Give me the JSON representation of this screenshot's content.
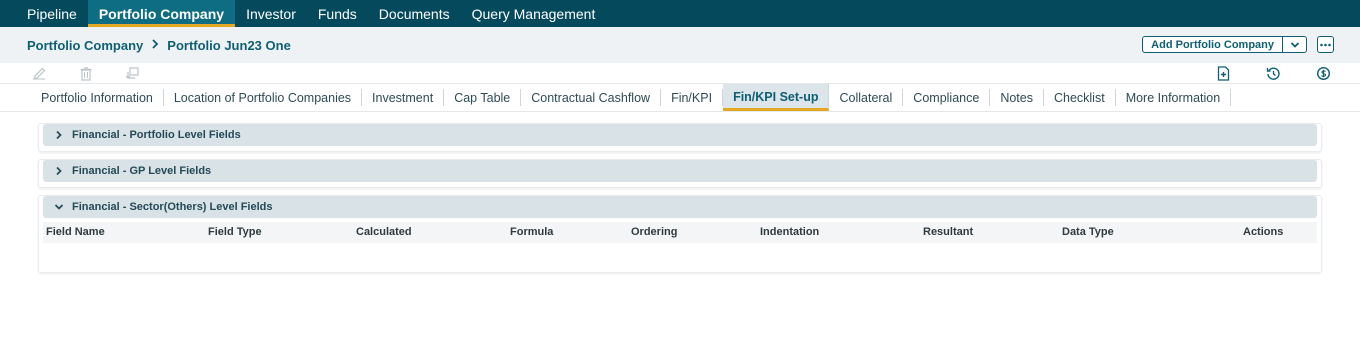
{
  "topnav": {
    "items": [
      {
        "label": "Pipeline"
      },
      {
        "label": "Portfolio Company"
      },
      {
        "label": "Investor"
      },
      {
        "label": "Funds"
      },
      {
        "label": "Documents"
      },
      {
        "label": "Query Management"
      }
    ],
    "active_index": 1
  },
  "breadcrumb": {
    "root": "Portfolio Company",
    "current": "Portfolio Jun23 One"
  },
  "header_actions": {
    "add_label": "Add Portfolio Company"
  },
  "tabs": [
    {
      "label": "Portfolio Information"
    },
    {
      "label": "Location of Portfolio Companies"
    },
    {
      "label": "Investment"
    },
    {
      "label": "Cap Table"
    },
    {
      "label": "Contractual Cashflow"
    },
    {
      "label": "Fin/KPI"
    },
    {
      "label": "Fin/KPI Set-up"
    },
    {
      "label": "Collateral"
    },
    {
      "label": "Compliance"
    },
    {
      "label": "Notes"
    },
    {
      "label": "Checklist"
    },
    {
      "label": "More Information"
    }
  ],
  "active_tab_index": 6,
  "sections": [
    {
      "title": "Financial - Portfolio Level Fields",
      "expanded": false
    },
    {
      "title": "Financial - GP Level Fields",
      "expanded": false
    },
    {
      "title": "Financial - Sector(Others) Level Fields",
      "expanded": true
    }
  ],
  "table": {
    "columns": [
      "Field Name",
      "Field Type",
      "Calculated",
      "Formula",
      "Ordering",
      "Indentation",
      "Resultant",
      "Data Type",
      "Actions"
    ]
  },
  "colors": {
    "nav_bg": "#044a5c",
    "accent": "#e5a823",
    "brand_text": "#0e5f73"
  }
}
